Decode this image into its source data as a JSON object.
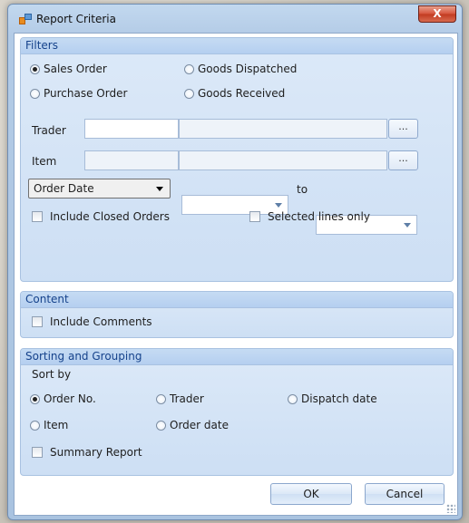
{
  "window": {
    "title": "Report Criteria",
    "close_label": "X"
  },
  "filters": {
    "header": "Filters",
    "order_type_options": [
      {
        "label": "Sales Order",
        "checked": true
      },
      {
        "label": "Purchase Order",
        "checked": false
      },
      {
        "label": "Goods Dispatched",
        "checked": false
      },
      {
        "label": "Goods Received",
        "checked": false
      }
    ],
    "trader": {
      "label": "Trader",
      "code": "",
      "name": "",
      "browse_label": "..."
    },
    "item": {
      "label": "Item",
      "code": "",
      "name": "",
      "browse_label": "..."
    },
    "date_type": {
      "selected": "Order Date"
    },
    "date_from": "",
    "date_to_label": "to",
    "date_to": "",
    "include_closed_orders": {
      "label": "Include Closed Orders",
      "checked": false
    },
    "selected_lines_only": {
      "label": "Selected lines only",
      "checked": false
    }
  },
  "content": {
    "header": "Content",
    "include_comments": {
      "label": "Include Comments",
      "checked": false
    }
  },
  "sorting": {
    "header": "Sorting and Grouping",
    "sort_by_label": "Sort by",
    "options": [
      {
        "label": "Order No.",
        "checked": true
      },
      {
        "label": "Trader",
        "checked": false
      },
      {
        "label": "Dispatch date",
        "checked": false
      },
      {
        "label": "Item",
        "checked": false
      },
      {
        "label": "Order date",
        "checked": false
      }
    ],
    "summary_report": {
      "label": "Summary Report",
      "checked": false
    }
  },
  "buttons": {
    "ok": "OK",
    "cancel": "Cancel"
  },
  "colors": {
    "accent_header_text": "#15428b",
    "close_button": "#c13a20",
    "group_background": "#cddff4"
  },
  "icons": [
    "app-window-icon",
    "close-icon",
    "dropdown-arrow-icon"
  ]
}
